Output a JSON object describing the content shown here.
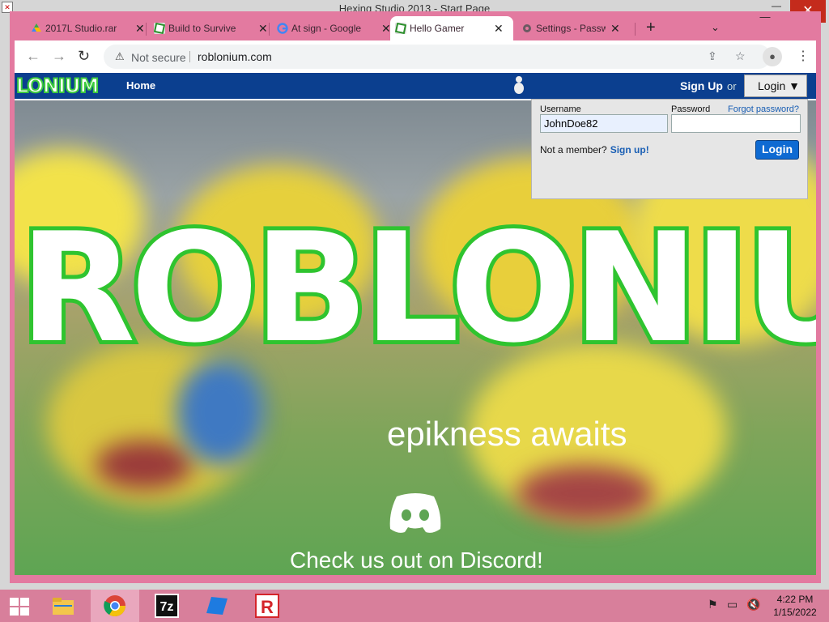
{
  "background_window": {
    "title": "Hexing Studio 2013 - Start Page",
    "close_glyph": "✕",
    "maximize_glyph": "▭",
    "minimize_glyph": "—"
  },
  "browser": {
    "tabs": [
      {
        "title": "2017L Studio.rar",
        "icon": "google-drive-icon",
        "active": false
      },
      {
        "title": "Build to Survive",
        "icon": "roblonium-icon",
        "active": false
      },
      {
        "title": "At sign - Google",
        "icon": "google-icon",
        "active": false
      },
      {
        "title": "Hello Gamer",
        "icon": "roblonium-icon",
        "active": true
      },
      {
        "title": "Settings - Passwords",
        "icon": "gear-icon",
        "active": false
      }
    ],
    "tab_close": "✕",
    "new_tab": "+",
    "tab_search": "⌄",
    "window": {
      "minimize": "—",
      "maximize": "▭",
      "close": "✕"
    },
    "toolbar": {
      "back": "←",
      "forward": "→",
      "reload": "↻",
      "security_text": "Not secure",
      "url": "roblonium.com",
      "share_glyph": "⇪",
      "star_glyph": "☆",
      "profile_glyph": "●",
      "menu_glyph": "⋮"
    }
  },
  "site": {
    "logo_text": "LONIUM",
    "nav_home": "Home",
    "signup": "Sign Up",
    "or": "or",
    "login_toggle": "Login ▼",
    "login_panel": {
      "username_label": "Username",
      "username_value": "JohnDoe82",
      "password_label": "Password",
      "password_value": "",
      "forgot": "Forgot password?",
      "not_member": "Not a member?",
      "signup_link": "Sign up!",
      "login_button": "Login"
    },
    "hero_logo_text": "ROBLONIU",
    "tagline": "epikness awaits",
    "discord_cta": "Check us out on Discord!"
  },
  "taskbar": {
    "apps": [
      {
        "name": "file-explorer",
        "active": false
      },
      {
        "name": "chrome",
        "active": true
      },
      {
        "name": "7zip",
        "label": "7z",
        "active": false
      },
      {
        "name": "app-blue",
        "active": false
      },
      {
        "name": "roblonium-studio",
        "label": "R",
        "active": false
      }
    ],
    "time": "4:22 PM",
    "date": "1/15/2022"
  },
  "colors": {
    "window_accent": "#e37aa0",
    "site_header": "#0b3f8f",
    "logo_green": "#3dcc3d",
    "link_blue": "#1a5fb4",
    "login_button": "#0e6ad2"
  }
}
